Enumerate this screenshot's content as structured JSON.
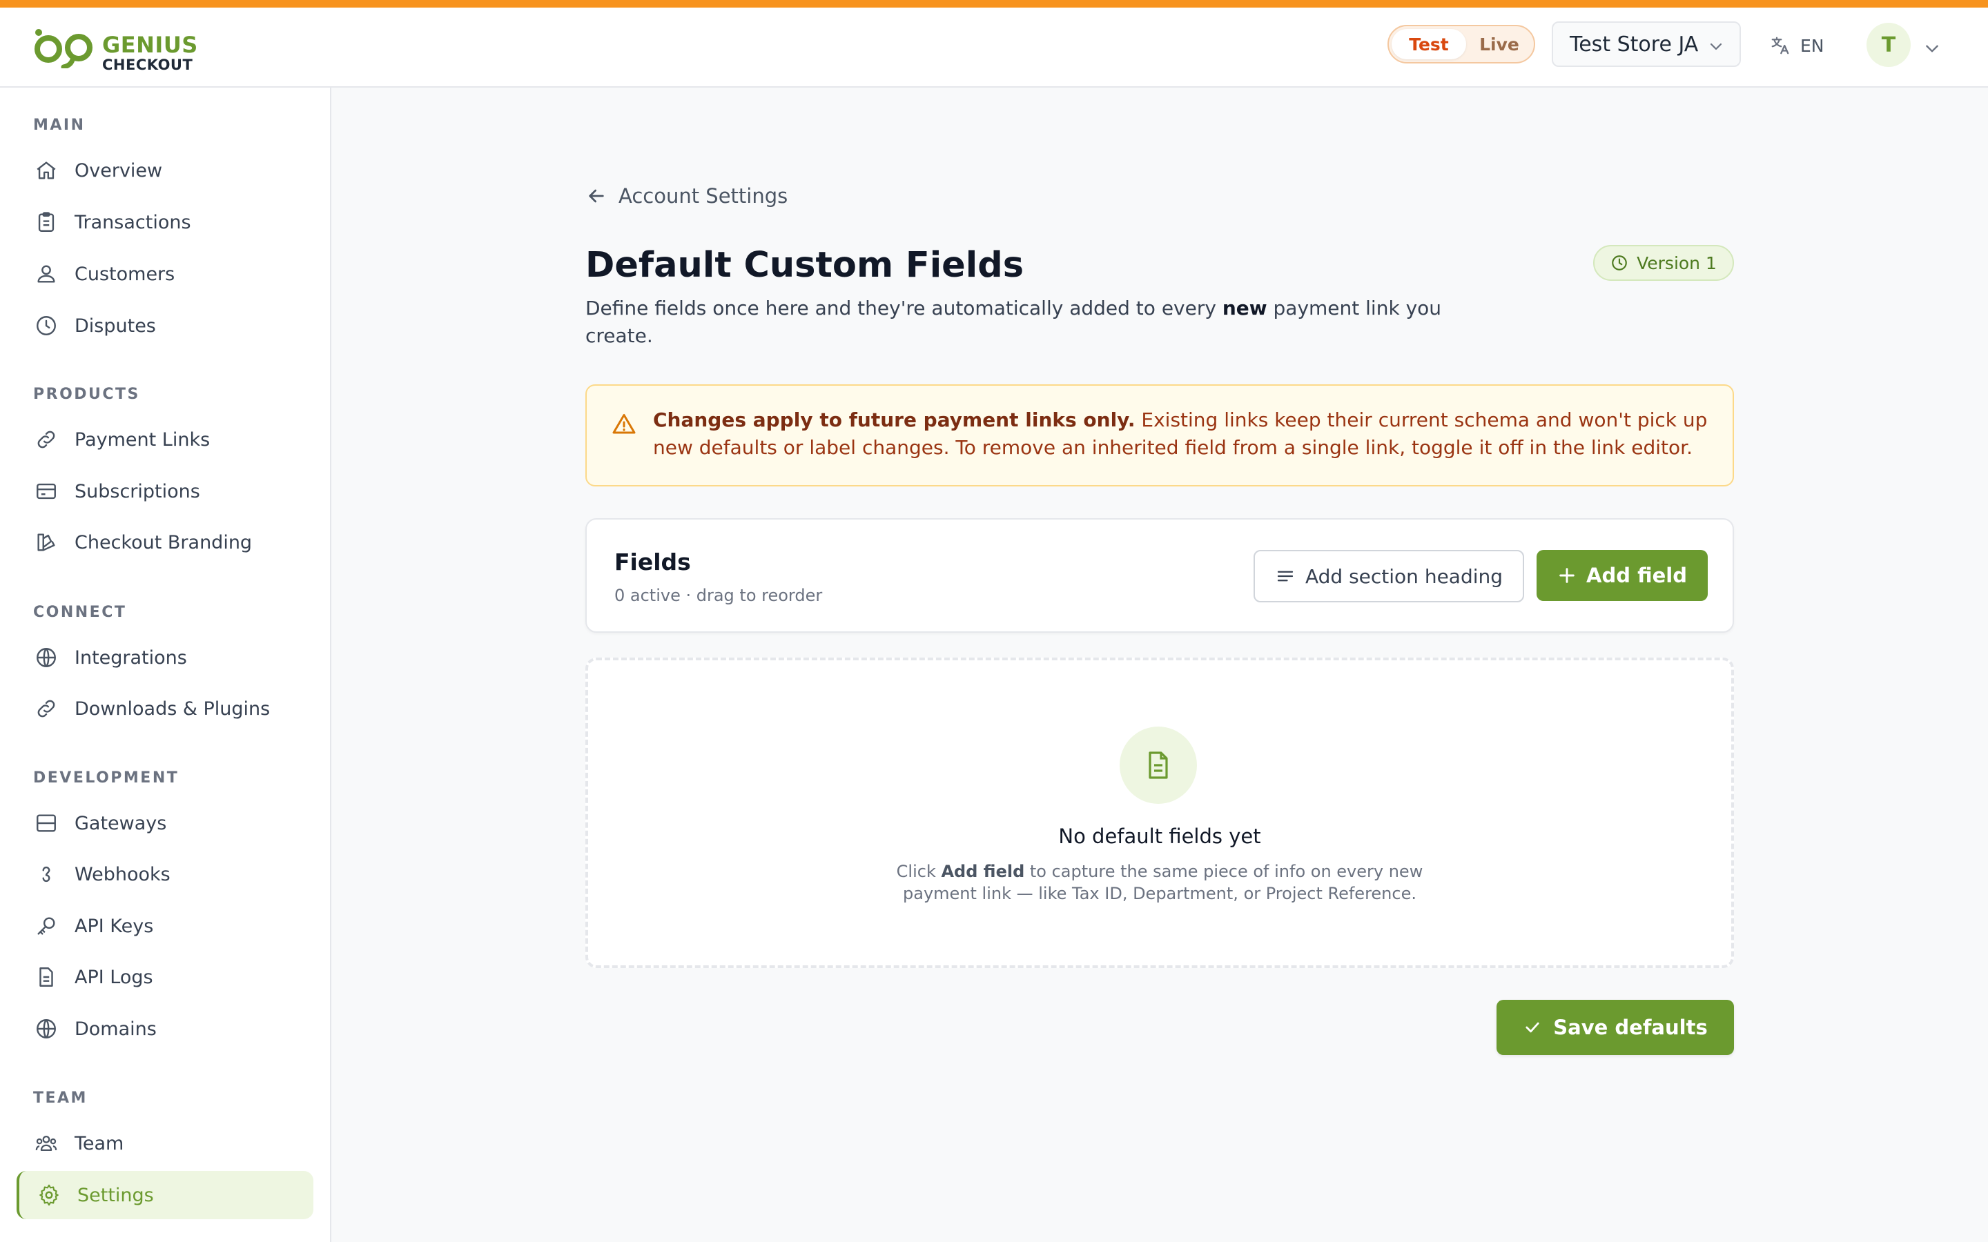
{
  "brand": {
    "name_line1": "GENIUS",
    "name_line2": "CHECKOUT",
    "accent": "#6b9a2f",
    "top_strip": "#f7931e"
  },
  "header": {
    "mode": {
      "test_label": "Test",
      "live_label": "Live",
      "selected": "Test"
    },
    "store_selector": {
      "value": "Test Store JA",
      "icon": "chevron-down-icon"
    },
    "language": {
      "label": "EN",
      "icon": "translate-icon"
    },
    "user": {
      "initial": "T",
      "icon": "chevron-down-icon"
    }
  },
  "sidebar": {
    "sections": [
      {
        "label": "MAIN",
        "items": [
          {
            "label": "Overview",
            "icon": "home-icon"
          },
          {
            "label": "Transactions",
            "icon": "clipboard-icon"
          },
          {
            "label": "Customers",
            "icon": "users-icon"
          },
          {
            "label": "Disputes",
            "icon": "clock-icon"
          }
        ]
      },
      {
        "label": "PRODUCTS",
        "items": [
          {
            "label": "Payment Links",
            "icon": "link-icon"
          },
          {
            "label": "Subscriptions",
            "icon": "card-icon"
          },
          {
            "label": "Checkout Branding",
            "icon": "palette-icon"
          }
        ]
      },
      {
        "label": "CONNECT",
        "items": [
          {
            "label": "Integrations",
            "icon": "globe-icon"
          },
          {
            "label": "Downloads & Plugins",
            "icon": "link-icon"
          }
        ]
      },
      {
        "label": "DEVELOPMENT",
        "items": [
          {
            "label": "Gateways",
            "icon": "server-icon"
          },
          {
            "label": "Webhooks",
            "icon": "webhook-icon"
          },
          {
            "label": "API Keys",
            "icon": "key-icon"
          },
          {
            "label": "API Logs",
            "icon": "file-icon"
          },
          {
            "label": "Domains",
            "icon": "globe-icon"
          }
        ]
      },
      {
        "label": "TEAM",
        "items": [
          {
            "label": "Team",
            "icon": "team-icon"
          },
          {
            "label": "Settings",
            "icon": "gear-icon",
            "active": true
          }
        ]
      }
    ]
  },
  "page": {
    "back_label": "Account Settings",
    "title": "Default Custom Fields",
    "description_before": "Define fields once here and they're automatically added to every ",
    "description_bold": "new",
    "description_after": " payment link you create.",
    "version_label": "Version 1"
  },
  "notice": {
    "bold": "Changes apply to future payment links only.",
    "text": " Existing links keep their current schema and won't pick up new defaults or label changes. To remove an inherited field from a single link, toggle it off in the link editor."
  },
  "fields_card": {
    "title": "Fields",
    "subtitle": "0 active · drag to reorder",
    "add_heading_label": "Add section heading",
    "add_field_label": "Add field"
  },
  "empty_state": {
    "title": "No default fields yet",
    "desc_before": "Click ",
    "desc_bold": "Add field",
    "desc_after": " to capture the same piece of info on every new payment link — like Tax ID, Department, or Project Reference."
  },
  "save_label": "Save defaults"
}
